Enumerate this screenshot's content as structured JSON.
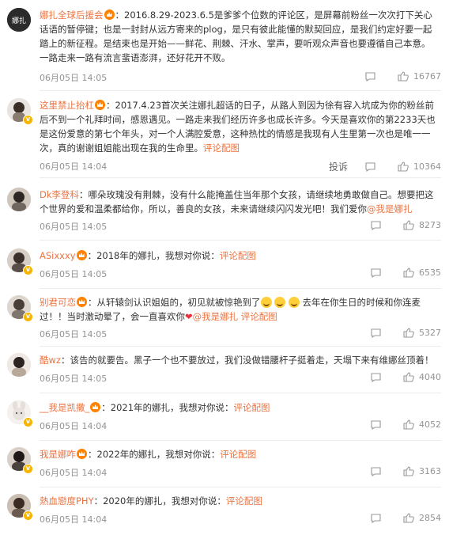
{
  "comments": [
    {
      "user": "娜扎全球后援会",
      "text": "：2016.8.29-2023.6.5是爹爹个位数的评论区，是屏幕前粉丝一次次打下关心话语的暂停键；也是一封封从远方寄来的plog，是只有彼此能懂的默契回应，是我们约定好要一起踏上的新征程。是结束也是开始——鲜花、荆棘、汗水、掌声，要听观众声音也要遵循自己本意。一路走来一路有流言蜚语澎湃，还好花开不败。",
      "date": "06月05日 14:05",
      "likes": "16767",
      "avatar_color": "#2b2b2b"
    },
    {
      "user": "这里禁止抬杠",
      "text": "：2017.4.23首次关注娜扎超话的日子，从路人到因为徐有容入坑成为你的粉丝前后不到一个礼拜时间，感恩遇见。一路走来我们经历许多也成长许多。今天是喜欢你的第2233天也是这份爱意的第七个年头，对一个人满腔爱意，这种热忱的情感是我现有人生里第一次也是唯一一次，真的谢谢姐姐能出现在我的生命里。",
      "link": "评论配图",
      "date": "06月05日 14:04",
      "report": "投诉",
      "likes": "10364",
      "avatar_color": "#8a7b70"
    },
    {
      "user": "Dk李登科",
      "text": "：哪朵玫瑰没有荆棘，没有什么能掩盖住当年那个女孩，请继续地勇敢做自己。想要把这个世界的爱和温柔都给你，所以，善良的女孩，未来请继续闪闪发光吧！我们爱你",
      "mention": "@我是娜扎",
      "date": "06月05日 14:05",
      "likes": "8273",
      "avatar_color": "#6f6660"
    },
    {
      "user": "ASixxxy",
      "text": "：2018年的娜扎，我想对你说：",
      "link": "评论配图",
      "date": "06月05日 14:05",
      "likes": "6535",
      "avatar_color": "#5a4f48"
    },
    {
      "user": "别君可恋",
      "text_a": "：从轩辕剑认识姐姐的，初见就被惊艳到了",
      "text_b": "去年在你生日的时候和你连麦过！！当时激动晕了，会一直喜欢你",
      "mention": "@我是娜扎",
      "link": "评论配图",
      "date": "06月05日 14:05",
      "likes": "5327",
      "avatar_color": "#7f766d"
    },
    {
      "user": "酷wz",
      "text": "：该告的就要告。黑子一个也不要放过，我们没做错腰杆子挺着走，天塌下来有维娜丝顶着！",
      "date": "06月05日 14:05",
      "likes": "4040",
      "avatar_color": "#b8a89a"
    },
    {
      "user": "__我是凯撒_",
      "text": "：2021年的娜扎，我想对你说：",
      "link": "评论配图",
      "date": "06月05日 14:04",
      "likes": "4052",
      "avatar_color": "#e8e2dc"
    },
    {
      "user": "我是娜咋",
      "text": "：2022年的娜扎，我想对你说：",
      "link": "评论配图",
      "date": "06月05日 14:04",
      "likes": "3163",
      "avatar_color": "#4a423c"
    },
    {
      "user": "熱血戀度PHY",
      "text": "：2020年的娜扎，我想对你说：",
      "link": "评论配图",
      "date": "06月05日 14:04",
      "likes": "2854",
      "avatar_color": "#6b5a50"
    }
  ],
  "icons": {
    "reply": "comment-icon",
    "like": "thumbs-up-icon",
    "badge": "crown-badge-icon",
    "verified": "verified-v-icon"
  }
}
